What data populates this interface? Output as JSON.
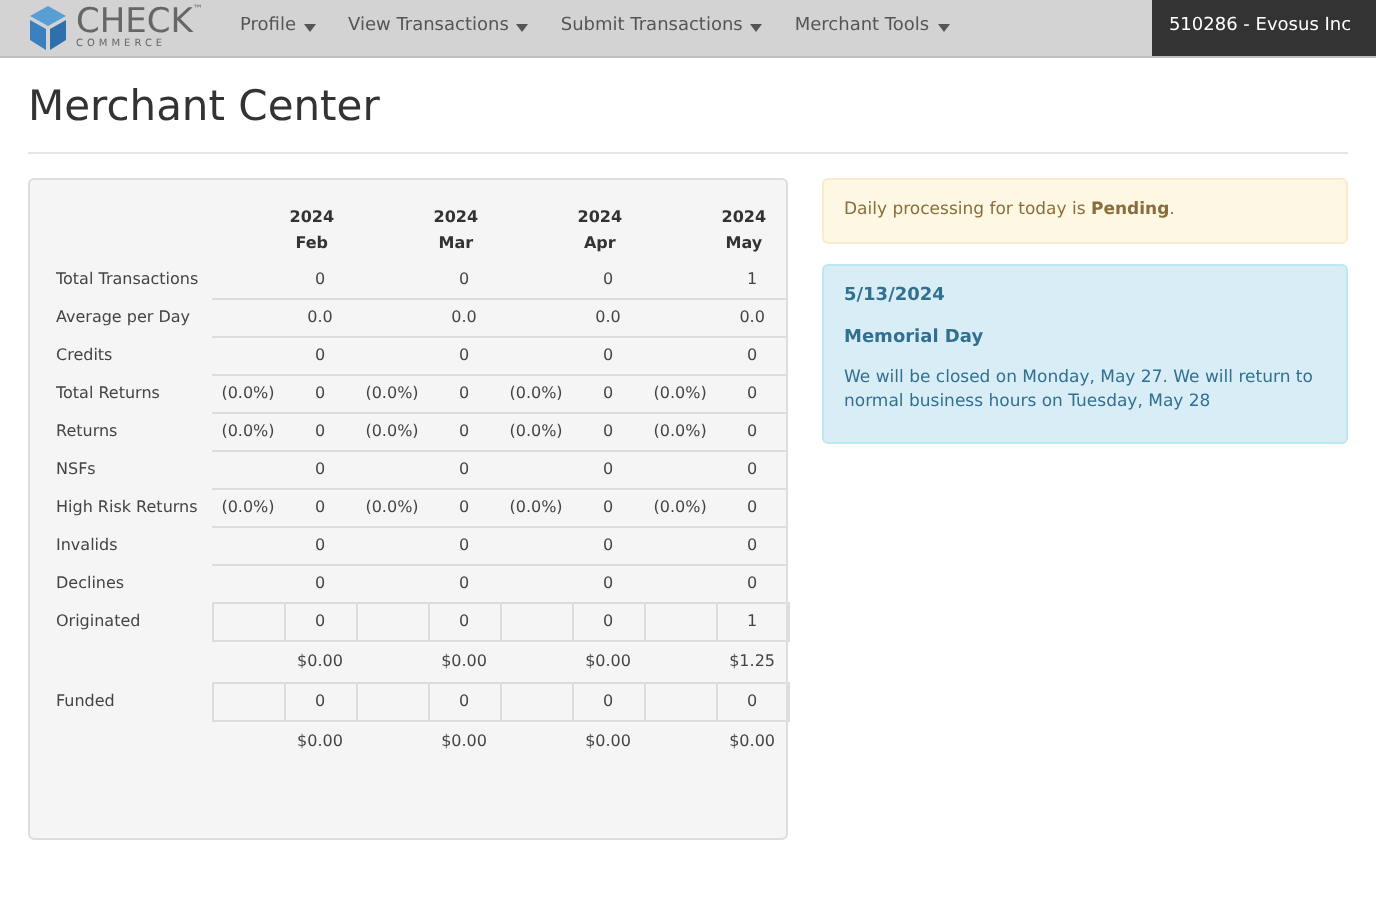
{
  "navbar": {
    "logo": {
      "word": "CHECK",
      "mark": "™",
      "sub": "COMMERCE"
    },
    "menus": [
      "Profile",
      "View Transactions",
      "Submit Transactions",
      "Merchant Tools"
    ],
    "account": "510286 - Evosus Inc"
  },
  "page_title": "Merchant Center",
  "table": {
    "columns": [
      {
        "year": "2024",
        "month": "Feb"
      },
      {
        "year": "2024",
        "month": "Mar"
      },
      {
        "year": "2024",
        "month": "Apr"
      },
      {
        "year": "2024",
        "month": "May"
      }
    ],
    "rows": [
      {
        "label": "Total Transactions",
        "kind": "plain",
        "cells": [
          {
            "value": "0"
          },
          {
            "value": "0"
          },
          {
            "value": "0"
          },
          {
            "value": "1"
          }
        ]
      },
      {
        "label": "Average per Day",
        "kind": "plain",
        "cells": [
          {
            "value": "0.0"
          },
          {
            "value": "0.0"
          },
          {
            "value": "0.0"
          },
          {
            "value": "0.0"
          }
        ]
      },
      {
        "label": "Credits",
        "kind": "plain",
        "cells": [
          {
            "value": "0"
          },
          {
            "value": "0"
          },
          {
            "value": "0"
          },
          {
            "value": "0"
          }
        ]
      },
      {
        "label": "Total Returns",
        "kind": "plain",
        "cells": [
          {
            "pct": "(0.0%)",
            "value": "0"
          },
          {
            "pct": "(0.0%)",
            "value": "0"
          },
          {
            "pct": "(0.0%)",
            "value": "0"
          },
          {
            "pct": "(0.0%)",
            "value": "0"
          }
        ]
      },
      {
        "label": "Returns",
        "kind": "plain",
        "cells": [
          {
            "pct": "(0.0%)",
            "value": "0"
          },
          {
            "pct": "(0.0%)",
            "value": "0"
          },
          {
            "pct": "(0.0%)",
            "value": "0"
          },
          {
            "pct": "(0.0%)",
            "value": "0"
          }
        ]
      },
      {
        "label": "NSFs",
        "kind": "plain",
        "cells": [
          {
            "value": "0"
          },
          {
            "value": "0"
          },
          {
            "value": "0"
          },
          {
            "value": "0"
          }
        ]
      },
      {
        "label": "High Risk Returns",
        "kind": "plain",
        "cells": [
          {
            "pct": "(0.0%)",
            "value": "0"
          },
          {
            "pct": "(0.0%)",
            "value": "0"
          },
          {
            "pct": "(0.0%)",
            "value": "0"
          },
          {
            "pct": "(0.0%)",
            "value": "0"
          }
        ]
      },
      {
        "label": "Invalids",
        "kind": "plain",
        "cells": [
          {
            "value": "0"
          },
          {
            "value": "0"
          },
          {
            "value": "0"
          },
          {
            "value": "0"
          }
        ]
      },
      {
        "label": "Declines",
        "kind": "plain",
        "cells": [
          {
            "value": "0"
          },
          {
            "value": "0"
          },
          {
            "value": "0"
          },
          {
            "value": "0"
          }
        ]
      },
      {
        "label": "Originated",
        "kind": "boxed",
        "cells": [
          {
            "value": "0"
          },
          {
            "value": "0"
          },
          {
            "value": "0"
          },
          {
            "value": "1"
          }
        ],
        "amounts": [
          "$0.00",
          "$0.00",
          "$0.00",
          "$1.25"
        ]
      },
      {
        "label": "Funded",
        "kind": "boxed",
        "cells": [
          {
            "value": "0"
          },
          {
            "value": "0"
          },
          {
            "value": "0"
          },
          {
            "value": "0"
          }
        ],
        "amounts": [
          "$0.00",
          "$0.00",
          "$0.00",
          "$0.00"
        ]
      }
    ]
  },
  "alert": "Daily processing for today is **Pending**.",
  "notice": {
    "date": "5/13/2024",
    "title": "Memorial Day",
    "body": "We will be closed on Monday, May 27. We will return to normal business hours on Tuesday, May 28"
  }
}
